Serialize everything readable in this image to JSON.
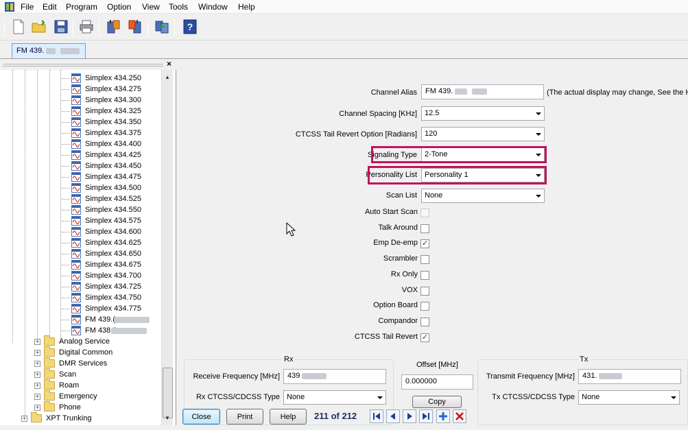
{
  "menu": [
    "File",
    "Edit",
    "Program",
    "Option",
    "View",
    "Tools",
    "Window",
    "Help"
  ],
  "toolbar_icons": [
    "new-file-icon",
    "open-folder-icon",
    "save-icon",
    "print-icon",
    "read-radio-icon",
    "write-radio-icon",
    "clone-icon",
    "help-icon"
  ],
  "tab": {
    "label": "FM 439."
  },
  "tree": {
    "channels": [
      "Simplex 434.250",
      "Simplex 434.275",
      "Simplex 434.300",
      "Simplex 434.325",
      "Simplex 434.350",
      "Simplex 434.375",
      "Simplex 434.400",
      "Simplex 434.425",
      "Simplex 434.450",
      "Simplex 434.475",
      "Simplex 434.500",
      "Simplex 434.525",
      "Simplex 434.550",
      "Simplex 434.575",
      "Simplex 434.600",
      "Simplex 434.625",
      "Simplex 434.650",
      "Simplex 434.675",
      "Simplex 434.700",
      "Simplex 434.725",
      "Simplex 434.750",
      "Simplex 434.775",
      "FM 439.(",
      "FM 438.8"
    ],
    "folders": [
      "Analog Service",
      "Digital Common",
      "DMR Services",
      "Scan",
      "Roam",
      "Emergency",
      "Phone"
    ],
    "root_folder": "XPT Trunking"
  },
  "form": {
    "channel_alias_label": "Channel Alias",
    "channel_alias_value": "FM 439.",
    "channel_alias_note": "(The actual display may change, See the H",
    "channel_spacing_label": "Channel Spacing [KHz]",
    "channel_spacing_value": "12.5",
    "ctcss_revert_label": "CTCSS Tail Revert Option [Radians]",
    "ctcss_revert_value": "120",
    "signaling_type_label": "Signaling Type",
    "signaling_type_value": "2-Tone",
    "personality_list_label": "Personality List",
    "personality_list_value": "Personality 1",
    "scan_list_label": "Scan List",
    "scan_list_value": "None",
    "checkboxes": [
      {
        "label": "Auto Start Scan",
        "checked": false,
        "disabled": true
      },
      {
        "label": "Talk Around",
        "checked": false,
        "disabled": false
      },
      {
        "label": "Emp De-emp",
        "checked": true,
        "disabled": false
      },
      {
        "label": "Scrambler",
        "checked": false,
        "disabled": false
      },
      {
        "label": "Rx Only",
        "checked": false,
        "disabled": false
      },
      {
        "label": "VOX",
        "checked": false,
        "disabled": false
      },
      {
        "label": "Option Board",
        "checked": false,
        "disabled": false
      },
      {
        "label": "Compandor",
        "checked": false,
        "disabled": false
      },
      {
        "label": "CTCSS Tail Revert",
        "checked": true,
        "disabled": false
      }
    ]
  },
  "rx": {
    "title": "Rx",
    "freq_label": "Receive Frequency [MHz]",
    "freq_value": "439",
    "ctcss_label": "Rx CTCSS/CDCSS Type",
    "ctcss_value": "None"
  },
  "offset": {
    "title": "Offset [MHz]",
    "value": "0.000000",
    "copy_label": "Copy"
  },
  "tx": {
    "title": "Tx",
    "freq_label": "Transmit Frequency [MHz]",
    "freq_value": "431.",
    "ctcss_label": "Tx CTCSS/CDCSS Type",
    "ctcss_value": "None"
  },
  "buttons": {
    "close": "Close",
    "print": "Print",
    "help": "Help"
  },
  "record_count": "211 of 212",
  "nav_icons": [
    "first-record-icon",
    "previous-record-icon",
    "next-record-icon",
    "last-record-icon",
    "add-record-icon",
    "delete-record-icon"
  ],
  "colors": {
    "highlight": "#c0145c",
    "nav_blue": "#1c3f9a",
    "delete_red": "#d01010"
  }
}
